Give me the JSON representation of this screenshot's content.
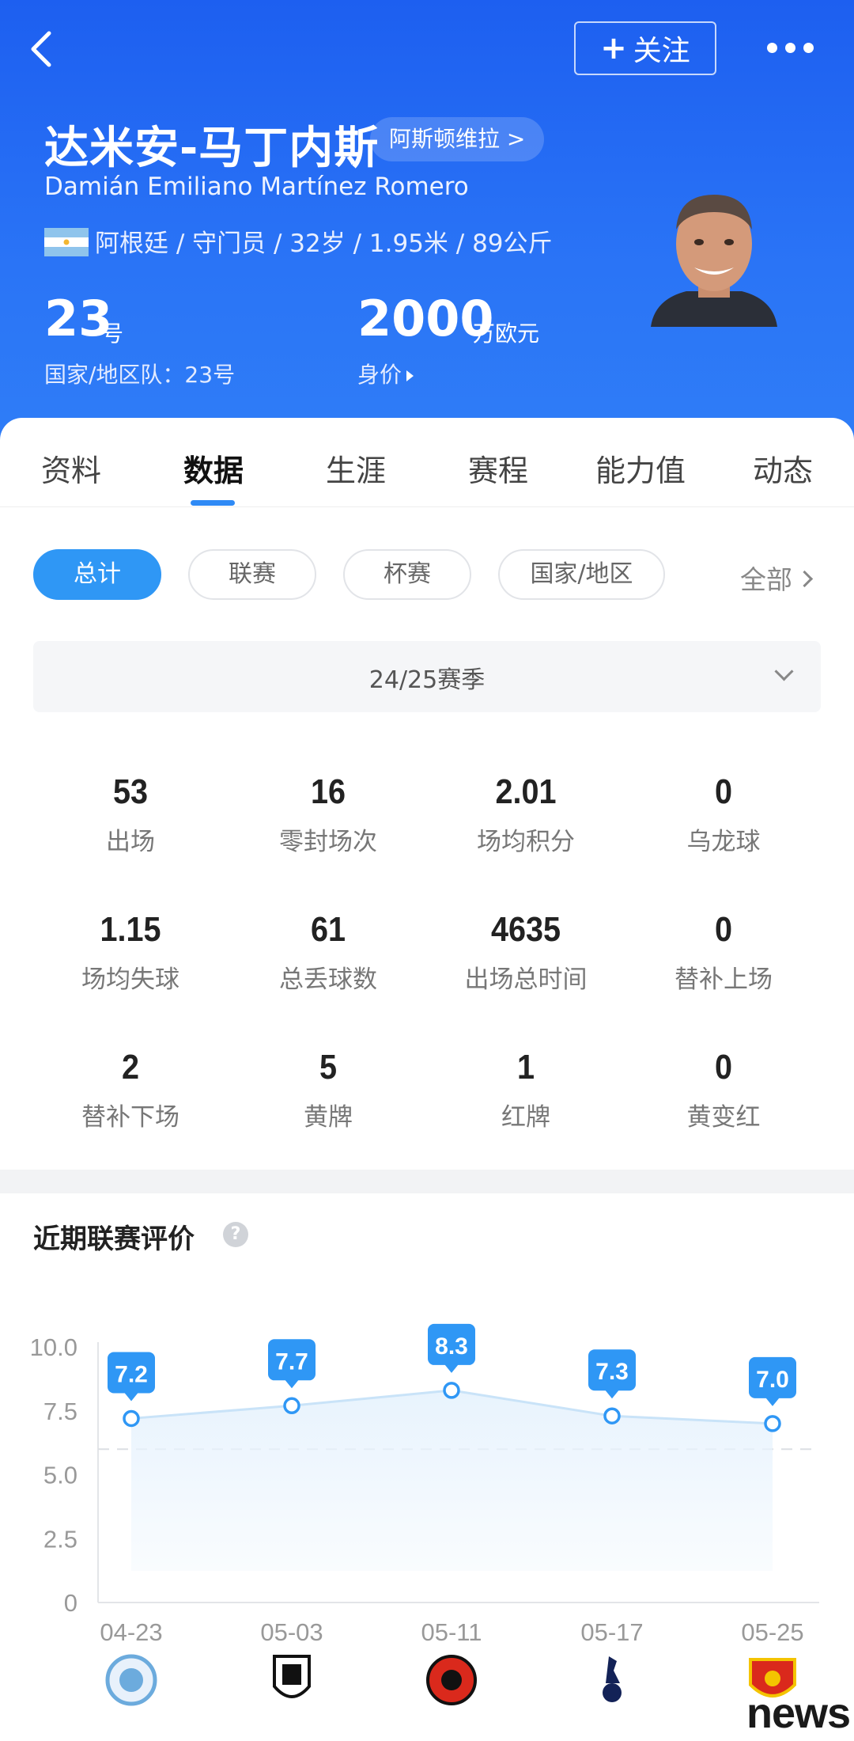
{
  "header": {
    "follow_label": "关注",
    "name_cn": "达米安-马丁内斯",
    "club": "阿斯顿维拉 >",
    "name_en": "Damián Emiliano Martínez Romero",
    "bio": "阿根廷 / 守门员 / 32岁 / 1.95米 / 89公斤",
    "shirt_number": "23",
    "shirt_unit": "号",
    "national_number": "国家/地区队：23号",
    "market_value": "2000",
    "market_value_unit": "万欧元",
    "market_value_label": "身价"
  },
  "tabs": [
    "资料",
    "数据",
    "生涯",
    "赛程",
    "能力值",
    "动态"
  ],
  "active_tab": "数据",
  "filters": {
    "items": [
      "总计",
      "联赛",
      "杯赛",
      "国家/地区"
    ],
    "active": "总计",
    "all_label": "全部"
  },
  "season": "24/25赛季",
  "stats": [
    {
      "value": "53",
      "label": "出场"
    },
    {
      "value": "16",
      "label": "零封场次"
    },
    {
      "value": "2.01",
      "label": "场均积分"
    },
    {
      "value": "0",
      "label": "乌龙球"
    },
    {
      "value": "1.15",
      "label": "场均失球"
    },
    {
      "value": "61",
      "label": "总丢球数"
    },
    {
      "value": "4635",
      "label": "出场总时间"
    },
    {
      "value": "0",
      "label": "替补上场"
    },
    {
      "value": "2",
      "label": "替补下场"
    },
    {
      "value": "5",
      "label": "黄牌"
    },
    {
      "value": "1",
      "label": "红牌"
    },
    {
      "value": "0",
      "label": "黄变红"
    }
  ],
  "rating_title": "近期联赛评价",
  "chart_data": {
    "type": "area",
    "x": [
      "04-23",
      "05-03",
      "05-11",
      "05-17",
      "05-25"
    ],
    "values": [
      7.2,
      7.7,
      8.3,
      7.3,
      7.0
    ],
    "data_labels": [
      "7.2",
      "7.7",
      "8.3",
      "7.3",
      "7.0"
    ],
    "y_ticks": [
      "10.0",
      "7.5",
      "5.0",
      "2.5",
      "0"
    ],
    "ylim": [
      0,
      10
    ],
    "reference_line": 6.0,
    "opponents": [
      "manchester-city-crest-icon",
      "fulham-crest-icon",
      "bournemouth-crest-icon",
      "tottenham-crest-icon",
      "manchester-united-crest-icon"
    ],
    "colors": {
      "line": "#c9e3f8",
      "point": "#2f97f5",
      "label_bg": "#2f97f5",
      "fill": "#e8f3fd"
    }
  },
  "watermark": "news"
}
